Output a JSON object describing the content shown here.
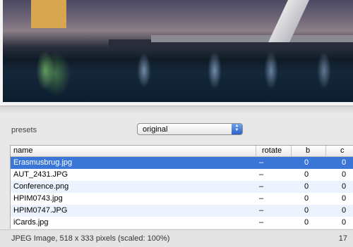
{
  "presets": {
    "label": "presets",
    "selected": "original"
  },
  "table": {
    "columns": [
      "name",
      "rotate",
      "b",
      "c"
    ],
    "rows": [
      {
        "name": "Erasmusbrug.jpg",
        "rotate": "–",
        "b": "0",
        "c": "0",
        "selected": true
      },
      {
        "name": "AUT_2431.JPG",
        "rotate": "–",
        "b": "0",
        "c": "0"
      },
      {
        "name": "Conference.png",
        "rotate": "–",
        "b": "0",
        "c": "0"
      },
      {
        "name": "HPIM0743.jpg",
        "rotate": "–",
        "b": "0",
        "c": "0"
      },
      {
        "name": "HPIM0747.JPG",
        "rotate": "–",
        "b": "0",
        "c": "0"
      },
      {
        "name": "iCards.jpg",
        "rotate": "–",
        "b": "0",
        "c": "0"
      }
    ]
  },
  "status": {
    "text": "JPEG Image, 518 x 333 pixels (scaled: 100%)",
    "count": "17"
  },
  "colors": {
    "selection": "#3a76d6",
    "alt_row": "#edf3fe",
    "select_button": "#2a62c9"
  }
}
